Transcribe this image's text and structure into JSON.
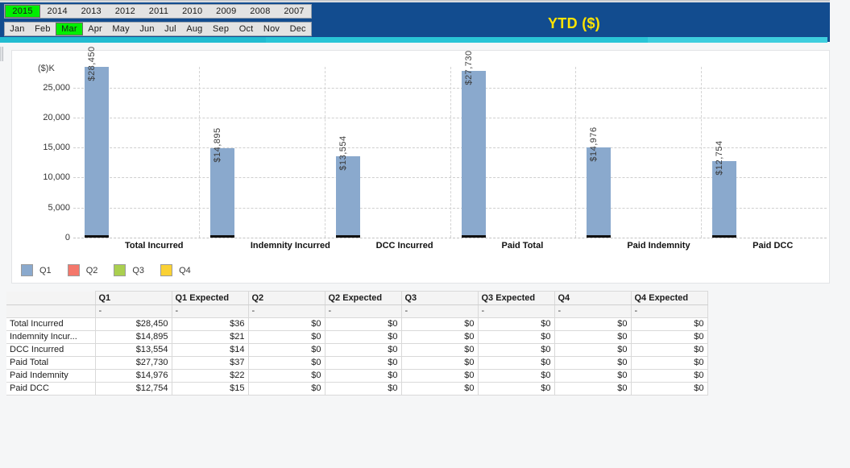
{
  "header": {
    "title": "YTD ($)",
    "years": [
      {
        "label": "2015",
        "active": true
      },
      {
        "label": "2014",
        "active": false
      },
      {
        "label": "2013",
        "active": false
      },
      {
        "label": "2012",
        "active": false
      },
      {
        "label": "2011",
        "active": false
      },
      {
        "label": "2010",
        "active": false
      },
      {
        "label": "2009",
        "active": false
      },
      {
        "label": "2008",
        "active": false
      },
      {
        "label": "2007",
        "active": false
      }
    ],
    "months": [
      {
        "label": "Jan",
        "active": false
      },
      {
        "label": "Feb",
        "active": false
      },
      {
        "label": "Mar",
        "active": true
      },
      {
        "label": "Apr",
        "active": false
      },
      {
        "label": "May",
        "active": false
      },
      {
        "label": "Jun",
        "active": false
      },
      {
        "label": "Jul",
        "active": false
      },
      {
        "label": "Aug",
        "active": false
      },
      {
        "label": "Sep",
        "active": false
      },
      {
        "label": "Oct",
        "active": false
      },
      {
        "label": "Nov",
        "active": false
      },
      {
        "label": "Dec",
        "active": false
      }
    ],
    "colors": {
      "title_bar": "#124c8f",
      "title_text": "#ffe400",
      "accent_bar": "#27c0cf",
      "active_tab": "#00ee00"
    }
  },
  "chart_data": {
    "type": "bar",
    "title": "",
    "xlabel": "",
    "ylabel": "($)K",
    "ylim": [
      0,
      28450
    ],
    "yticks": [
      0,
      5000,
      10000,
      15000,
      20000,
      25000
    ],
    "ytick_labels": [
      "0",
      "5,000",
      "10,000",
      "15,000",
      "20,000",
      "25,000"
    ],
    "grid": true,
    "legend_position": "bottom-left",
    "categories": [
      "Total Incurred",
      "Indemnity Incurred",
      "DCC Incurred",
      "Paid Total",
      "Paid Indemnity",
      "Paid DCC"
    ],
    "series": [
      {
        "name": "Q1",
        "color": "#8aa9cd",
        "values": [
          28450,
          14895,
          13554,
          27730,
          14976,
          12754
        ],
        "data_labels": [
          "$28,450",
          "$14,895",
          "$13,554",
          "$27,730",
          "$14,976",
          "$12,754"
        ]
      },
      {
        "name": "Q2",
        "color": "#f4776b",
        "values": [
          0,
          0,
          0,
          0,
          0,
          0
        ],
        "data_labels": []
      },
      {
        "name": "Q3",
        "color": "#aacf4f",
        "values": [
          0,
          0,
          0,
          0,
          0,
          0
        ],
        "data_labels": []
      },
      {
        "name": "Q4",
        "color": "#fad134",
        "values": [
          0,
          0,
          0,
          0,
          0,
          0
        ],
        "data_labels": []
      }
    ],
    "legend": [
      "Q1",
      "Q2",
      "Q3",
      "Q4"
    ]
  },
  "table": {
    "columns": [
      "",
      "Q1",
      "Q1 Expected",
      "Q2",
      "Q2 Expected",
      "Q3",
      "Q3 Expected",
      "Q4",
      "Q4 Expected"
    ],
    "subheader": [
      "",
      "-",
      "-",
      "-",
      "-",
      "-",
      "-",
      "-",
      "-"
    ],
    "rows": [
      {
        "label": "Total Incurred",
        "values": [
          "$28,450",
          "$36",
          "$0",
          "$0",
          "$0",
          "$0",
          "$0",
          "$0"
        ]
      },
      {
        "label": "Indemnity Incur...",
        "values": [
          "$14,895",
          "$21",
          "$0",
          "$0",
          "$0",
          "$0",
          "$0",
          "$0"
        ]
      },
      {
        "label": "DCC Incurred",
        "values": [
          "$13,554",
          "$14",
          "$0",
          "$0",
          "$0",
          "$0",
          "$0",
          "$0"
        ]
      },
      {
        "label": "Paid Total",
        "values": [
          "$27,730",
          "$37",
          "$0",
          "$0",
          "$0",
          "$0",
          "$0",
          "$0"
        ]
      },
      {
        "label": "Paid Indemnity",
        "values": [
          "$14,976",
          "$22",
          "$0",
          "$0",
          "$0",
          "$0",
          "$0",
          "$0"
        ]
      },
      {
        "label": "Paid DCC",
        "values": [
          "$12,754",
          "$15",
          "$0",
          "$0",
          "$0",
          "$0",
          "$0",
          "$0"
        ]
      }
    ]
  }
}
